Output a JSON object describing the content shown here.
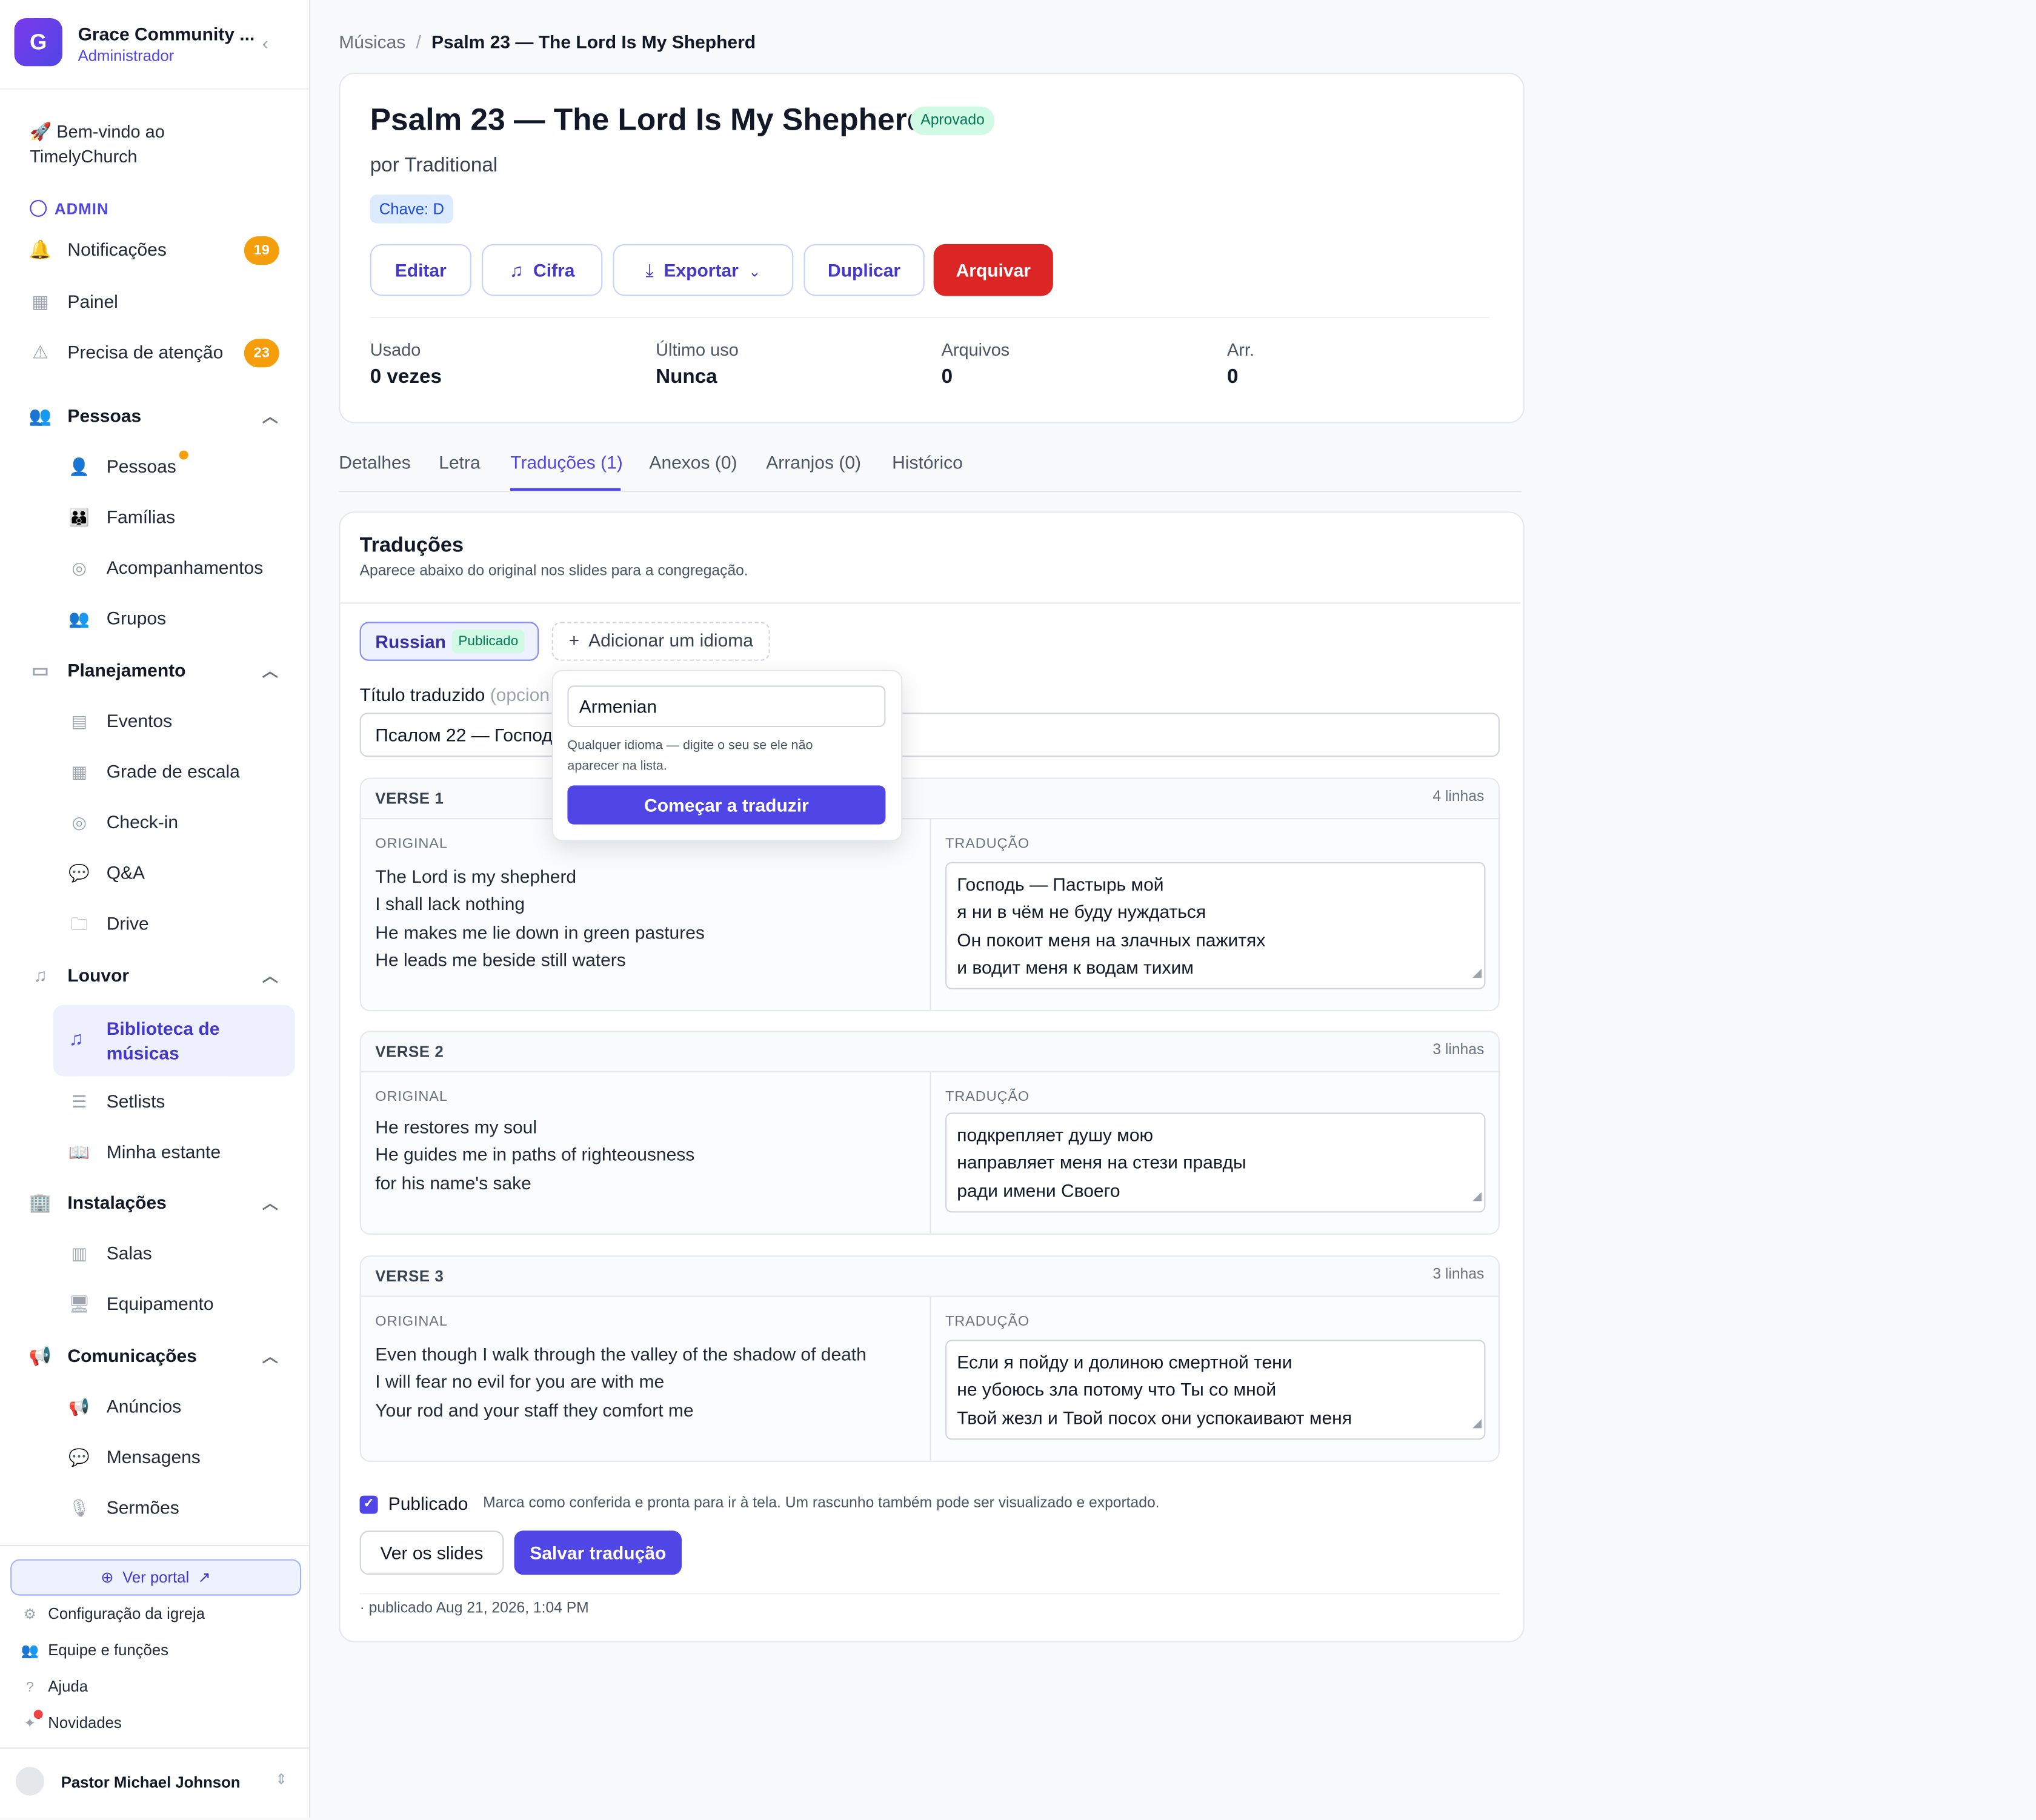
{
  "sidebar": {
    "org_initial": "G",
    "org_name": "Grace Community ...",
    "org_role": "Administrador",
    "welcome": "🚀 Bem-vindo ao TimelyChurch",
    "admin_label": "ADMIN",
    "notifications": {
      "label": "Notificações",
      "count": "19"
    },
    "dashboard": "Painel",
    "attention": {
      "label": "Precisa de atenção",
      "count": "23"
    },
    "people_section": "Pessoas",
    "people_items": [
      "Pessoas",
      "Famílias",
      "Acompanhamentos",
      "Grupos"
    ],
    "planning_section": "Planejamento",
    "planning_items": [
      "Eventos",
      "Grade de escala",
      "Check-in",
      "Q&A",
      "Drive"
    ],
    "worship_section": "Louvor",
    "worship_active": "Biblioteca de músicas",
    "worship_items": [
      "Setlists",
      "Minha estante"
    ],
    "facilities_section": "Instalações",
    "facilities_items": [
      "Salas",
      "Equipamento"
    ],
    "comms_section": "Comunicações",
    "comms_items": [
      "Anúncios",
      "Mensagens",
      "Sermões"
    ],
    "portal_button": "Ver portal",
    "utilities": [
      "Configuração da igreja",
      "Equipe e funções",
      "Ajuda",
      "Novidades"
    ],
    "user_name": "Pastor Michael Johnson"
  },
  "breadcrumb": {
    "parent": "Músicas",
    "separator": "/",
    "current": "Psalm 23 — The Lord Is My Shepherd"
  },
  "song": {
    "title": "Psalm 23 — The Lord Is My Shepherd",
    "status": "Aprovado",
    "author": "por Traditional",
    "key": "Chave: D",
    "actions": {
      "edit": "Editar",
      "chords": "Cifra",
      "export": "Exportar",
      "duplicate": "Duplicar",
      "archive": "Arquivar"
    },
    "stats": [
      {
        "label": "Usado",
        "value": "0 vezes"
      },
      {
        "label": "Último uso",
        "value": "Nunca"
      },
      {
        "label": "Arquivos",
        "value": "0"
      },
      {
        "label": "Arr.",
        "value": "0"
      }
    ]
  },
  "tabs": [
    "Detalhes",
    "Letra",
    "Traduções (1)",
    "Anexos (0)",
    "Arranjos (0)",
    "Histórico"
  ],
  "translations": {
    "title": "Traduções",
    "subtitle": "Aparece abaixo do original nos slides para a congregação.",
    "language": "Russian",
    "language_status": "Publicado",
    "add_language": "Adicionar um idioma",
    "title_label": "Título traduzido",
    "title_label_optional": "(opcion",
    "title_value": "Псалом 22 — Господ",
    "original_label": "ORIGINAL",
    "translation_label": "TRADUÇÃO",
    "verses": [
      {
        "name": "VERSE 1",
        "lines": "4 linhas",
        "original": [
          "The Lord is my shepherd",
          "I shall lack nothing",
          "He makes me lie down in green pastures",
          "He leads me beside still waters"
        ],
        "translation": [
          "Господь — Пастырь мой",
          "я ни в чём не буду нуждаться",
          "Он покоит меня на злачных пажитях",
          "и водит меня к водам тихим"
        ]
      },
      {
        "name": "VERSE 2",
        "lines": "3 linhas",
        "original": [
          "He restores my soul",
          "He guides me in paths of righteousness",
          "for his name's sake"
        ],
        "translation": [
          "подкрепляет душу мою",
          "направляет меня на стези правды",
          "ради имени Своего"
        ]
      },
      {
        "name": "VERSE 3",
        "lines": "3 linhas",
        "original": [
          "Even though I walk through the valley of the shadow of death",
          "I will fear no evil for you are with me",
          "Your rod and your staff they comfort me"
        ],
        "translation": [
          "Если я пойду и долиною смертной тени",
          "не убоюсь зла потому что Ты со мной",
          "Твой жезл и Твой посох они успокаивают меня"
        ]
      }
    ],
    "published_label": "Publicado",
    "published_desc": "Marca como conferida e pronta para ir à tela. Um rascunho também pode ser visualizado e exportado.",
    "view_slides": "Ver os slides",
    "save": "Salvar tradução",
    "footnote": "· publicado Aug 21, 2026, 1:04 PM"
  },
  "popover": {
    "input_value": "Armenian",
    "help": "Qualquer idioma — digite o seu se ele não aparecer na lista.",
    "button": "Começar a traduzir"
  },
  "colors": {
    "accent": "#4f46e5",
    "danger": "#dc2626",
    "badge": "#f59e0b",
    "success_bg": "#d1fae5"
  }
}
